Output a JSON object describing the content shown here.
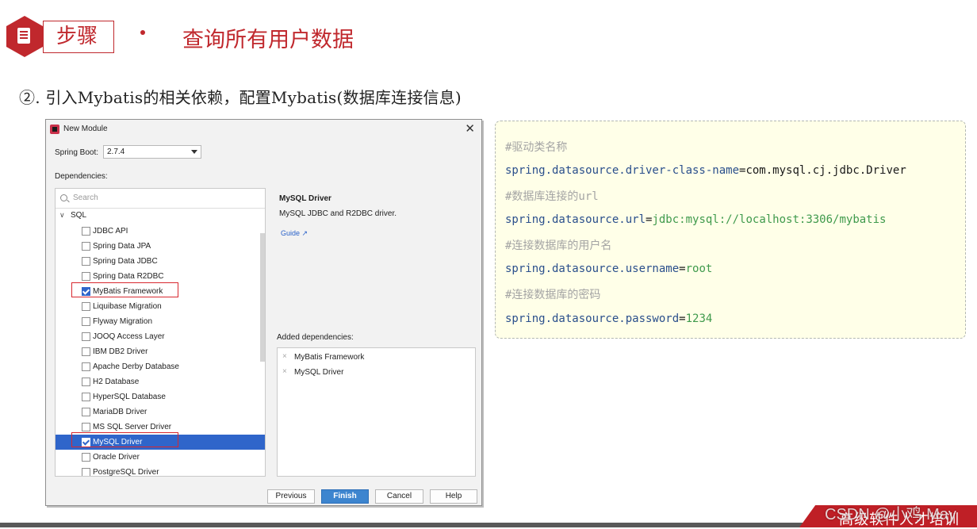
{
  "header": {
    "step_label": "步骤",
    "title": "查询所有用户数据"
  },
  "subtitle": "②. 引入Mybatis的相关依赖，配置Mybatis(数据库连接信息)",
  "dialog": {
    "title": "New Module",
    "spring_boot_label": "Spring Boot:",
    "spring_boot_version": "2.7.4",
    "dependencies_label": "Dependencies:",
    "search_placeholder": "Search",
    "group": "SQL",
    "items": [
      {
        "label": "JDBC API",
        "checked": false
      },
      {
        "label": "Spring Data JPA",
        "checked": false
      },
      {
        "label": "Spring Data JDBC",
        "checked": false
      },
      {
        "label": "Spring Data R2DBC",
        "checked": false
      },
      {
        "label": "MyBatis Framework",
        "checked": true
      },
      {
        "label": "Liquibase Migration",
        "checked": false
      },
      {
        "label": "Flyway Migration",
        "checked": false
      },
      {
        "label": "JOOQ Access Layer",
        "checked": false
      },
      {
        "label": "IBM DB2 Driver",
        "checked": false
      },
      {
        "label": "Apache Derby Database",
        "checked": false
      },
      {
        "label": "H2 Database",
        "checked": false
      },
      {
        "label": "HyperSQL Database",
        "checked": false
      },
      {
        "label": "MariaDB Driver",
        "checked": false
      },
      {
        "label": "MS SQL Server Driver",
        "checked": false
      },
      {
        "label": "MySQL Driver",
        "checked": true,
        "selected": true
      },
      {
        "label": "Oracle Driver",
        "checked": false
      },
      {
        "label": "PostgreSQL Driver",
        "checked": false
      }
    ],
    "detail_title": "MySQL Driver",
    "detail_desc": "MySQL JDBC and R2DBC driver.",
    "guide_label": "Guide ↗",
    "added_label": "Added dependencies:",
    "added": [
      "MyBatis Framework",
      "MySQL Driver"
    ],
    "buttons": {
      "previous": "Previous",
      "finish": "Finish",
      "cancel": "Cancel",
      "help": "Help"
    }
  },
  "code": {
    "comment1": "#驱动类名称",
    "key1": "spring.datasource.driver-class-name",
    "val1": "com.mysql.cj.jdbc.Driver",
    "comment2": "#数据库连接的url",
    "key2": "spring.datasource.url",
    "val2": "jdbc:mysql://localhost:3306/mybatis",
    "comment3": "#连接数据库的用户名",
    "key3": "spring.datasource.username",
    "val3": "root",
    "comment4": "#连接数据库的密码",
    "key4": "spring.datasource.password",
    "val4": "1234",
    "eq": "="
  },
  "footer": {
    "brand": "高级软件人才培训",
    "watermark": "CSDN @小鸡 May"
  },
  "colors": {
    "accent": "#c0282d",
    "selection": "#2f65ca",
    "code_bg": "#ffffe8",
    "code_key": "#2a4f8c",
    "code_value": "#3f9a4c",
    "code_comment": "#a4a4a4"
  }
}
